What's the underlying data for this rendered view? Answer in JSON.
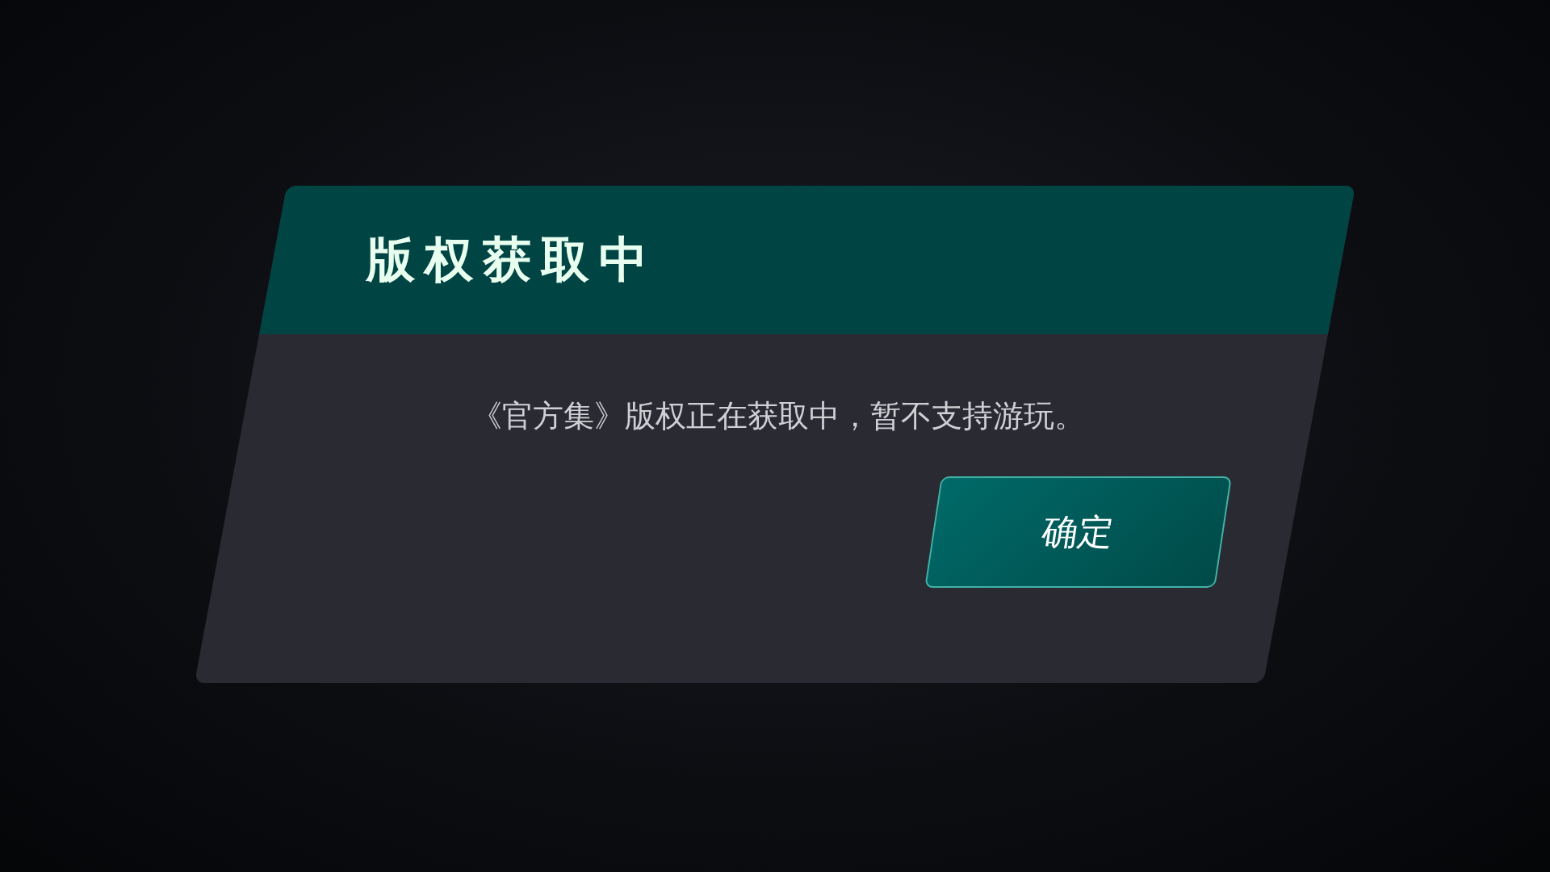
{
  "dialog": {
    "title": "版权获取中",
    "message": "《官方集》版权正在获取中，暂不支持游玩。",
    "buttons": [
      {
        "label": "确定"
      }
    ]
  }
}
